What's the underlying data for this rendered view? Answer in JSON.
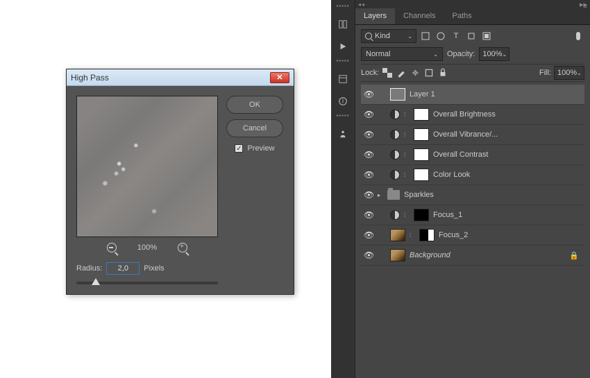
{
  "dialog": {
    "title": "High Pass",
    "ok": "OK",
    "cancel": "Cancel",
    "preview_label": "Preview",
    "zoom": "100%",
    "radius_label": "Radius:",
    "radius_value": "2,0",
    "radius_unit": "Pixels"
  },
  "panel": {
    "tabs": [
      "Layers",
      "Channels",
      "Paths"
    ],
    "kind": "Kind",
    "blend_mode": "Normal",
    "opacity_label": "Opacity:",
    "opacity_value": "100%",
    "lock_label": "Lock:",
    "fill_label": "Fill:",
    "fill_value": "100%",
    "layers": [
      {
        "name": "Layer 1",
        "type": "pixel",
        "selected": true
      },
      {
        "name": "Overall Brightness",
        "type": "adjust"
      },
      {
        "name": "Overall Vibrance/...",
        "type": "adjust"
      },
      {
        "name": "Overall Contrast",
        "type": "adjust"
      },
      {
        "name": "Color Look",
        "type": "adjust"
      },
      {
        "name": "Sparkles",
        "type": "group"
      },
      {
        "name": "Focus_1",
        "type": "adjust_black"
      },
      {
        "name": "Focus_2",
        "type": "pixel_mask"
      },
      {
        "name": "Background",
        "type": "bg"
      }
    ]
  }
}
